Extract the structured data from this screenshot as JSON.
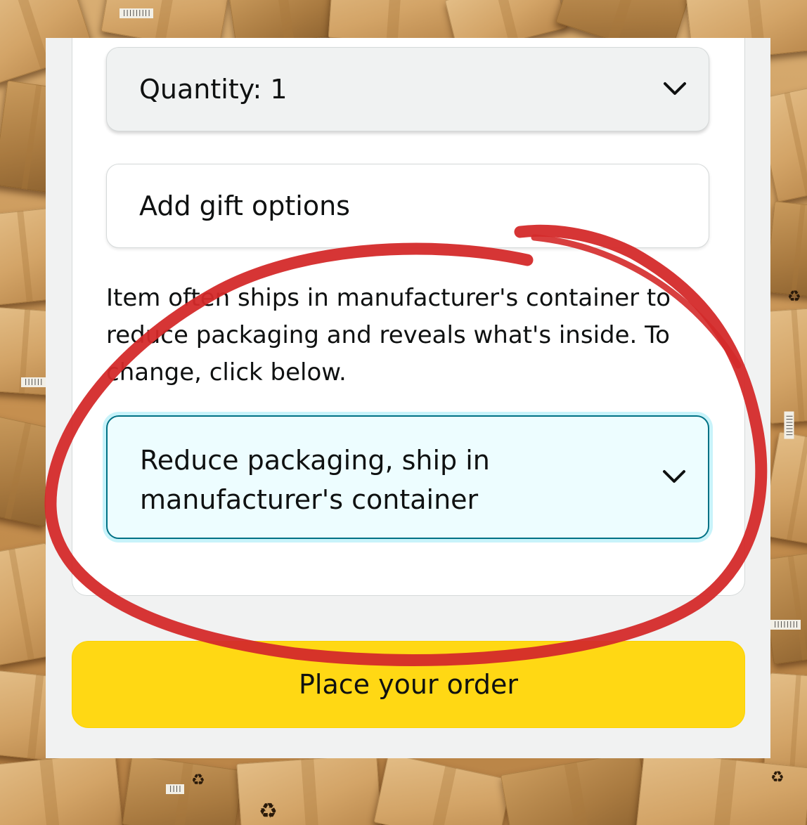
{
  "quantity": {
    "label": "Quantity:  1"
  },
  "gift": {
    "label": "Add gift options"
  },
  "packaging_note": "Item often ships in manufacturer's container to reduce packaging and reveals what's inside. To change, click below.",
  "packaging_select": {
    "selected": "Reduce packaging, ship in manufacturer's container"
  },
  "place_order": {
    "label": "Place your order"
  },
  "colors": {
    "button_yellow": "#ffd814",
    "selected_border": "#007185",
    "highlight_circle": "#d42a2a"
  },
  "icons": [
    "chevron-down-icon",
    "recycle-icon",
    "barcode-icon"
  ]
}
